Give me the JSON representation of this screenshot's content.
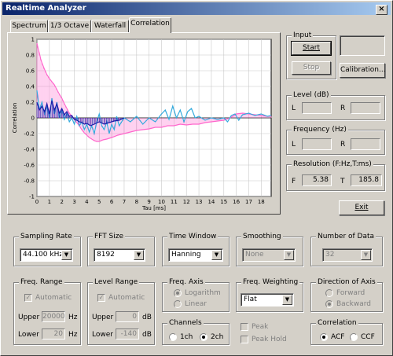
{
  "window": {
    "title": "Realtime Analyzer",
    "close_glyph": "×"
  },
  "tabs": [
    "Spectrum",
    "1/3 Octave",
    "Waterfall",
    "Correlation"
  ],
  "active_tab": 3,
  "chart_data": {
    "type": "line",
    "title": "",
    "xlabel": "Tau [ms]",
    "ylabel": "Correlation",
    "xlim": [
      0,
      18.8
    ],
    "ylim": [
      -1,
      1
    ],
    "xticks": [
      0,
      1,
      2,
      3,
      4,
      5,
      6,
      7,
      8,
      9,
      10,
      11,
      12,
      13,
      14,
      15,
      16,
      17,
      18
    ],
    "yticks": [
      "1",
      "0.8",
      "0.6",
      "0.4",
      "0.2",
      "0",
      "-0.2",
      "-0.4",
      "-0.6",
      "-0.8",
      "-1"
    ],
    "grid": true,
    "series": [
      {
        "color": "#ff66cc",
        "fill": true,
        "x": [
          0,
          0.1,
          0.2,
          0.3,
          0.4,
          0.6,
          0.8,
          1.0,
          1.2,
          1.4,
          1.6,
          1.8,
          2.0,
          2.2,
          2.4,
          2.6,
          2.8,
          3.0,
          3.2,
          3.4,
          3.6,
          3.8,
          4.0,
          4.2,
          4.4,
          4.6,
          4.8,
          5.0,
          5.3,
          5.6,
          6.0,
          6.5,
          7.0,
          7.5,
          8.0,
          8.5,
          9.0,
          9.5,
          10.0,
          10.5,
          11.0,
          11.5,
          12.0,
          12.5,
          13.0,
          13.5,
          14.0,
          14.5,
          15.0,
          15.5,
          16.0,
          16.5,
          17.0,
          17.5,
          18.0,
          18.5,
          18.8
        ],
        "y": [
          0.95,
          0.88,
          0.82,
          0.75,
          0.7,
          0.62,
          0.55,
          0.5,
          0.46,
          0.42,
          0.36,
          0.3,
          0.25,
          0.18,
          0.12,
          0.06,
          0.02,
          -0.02,
          -0.06,
          -0.1,
          -0.15,
          -0.19,
          -0.22,
          -0.25,
          -0.27,
          -0.29,
          -0.3,
          -0.3,
          -0.28,
          -0.27,
          -0.25,
          -0.22,
          -0.2,
          -0.18,
          -0.16,
          -0.15,
          -0.14,
          -0.12,
          -0.12,
          -0.1,
          -0.1,
          -0.08,
          -0.09,
          -0.08,
          -0.08,
          -0.06,
          -0.05,
          -0.04,
          -0.03,
          0.0,
          0.05,
          0.06,
          0.05,
          0.04,
          0.03,
          0.02,
          0.02
        ]
      },
      {
        "color": "#33aadd",
        "fill": false,
        "x": [
          0,
          0.2,
          0.4,
          0.6,
          0.8,
          1.0,
          1.2,
          1.4,
          1.6,
          1.8,
          2.0,
          2.2,
          2.4,
          2.6,
          2.8,
          3.0,
          3.2,
          3.4,
          3.6,
          3.8,
          4.0,
          4.2,
          4.4,
          4.6,
          4.8,
          5.0,
          5.2,
          5.4,
          5.6,
          5.8,
          6.0,
          6.2,
          6.4,
          6.6,
          6.8,
          7.0,
          7.5,
          8.0,
          8.5,
          9.0,
          9.5,
          10.0,
          10.3,
          10.6,
          10.9,
          11.2,
          11.5,
          11.8,
          12.1,
          12.4,
          12.7,
          13.0,
          13.5,
          14.0,
          14.5,
          15.0,
          15.3,
          15.6,
          15.9,
          16.2,
          16.5,
          17.0,
          17.5,
          18.0,
          18.5,
          18.8
        ],
        "y": [
          0.35,
          0.1,
          0.2,
          0.05,
          0.15,
          0.0,
          0.25,
          0.05,
          0.2,
          0.0,
          0.1,
          -0.02,
          0.05,
          -0.05,
          0.0,
          -0.08,
          0.02,
          -0.1,
          -0.05,
          -0.15,
          -0.08,
          -0.18,
          -0.1,
          -0.2,
          -0.05,
          0.05,
          -0.1,
          -0.15,
          -0.05,
          -0.2,
          -0.08,
          -0.15,
          0.02,
          -0.1,
          -0.05,
          0.0,
          -0.05,
          0.02,
          -0.08,
          0.0,
          -0.05,
          0.05,
          0.1,
          -0.02,
          0.15,
          0.0,
          0.1,
          -0.05,
          0.08,
          0.12,
          0.0,
          0.02,
          -0.03,
          0.0,
          -0.02,
          0.0,
          -0.05,
          0.03,
          0.05,
          -0.03,
          0.04,
          0.06,
          0.03,
          0.05,
          0.02,
          0.03
        ]
      },
      {
        "color": "#1a1aa8",
        "fill": true,
        "x": [
          0,
          0.2,
          0.4,
          0.6,
          0.8,
          1.0,
          1.2,
          1.4,
          1.6,
          1.8,
          2.0,
          2.2,
          2.4,
          2.6,
          2.8,
          3.0,
          3.2,
          3.4,
          3.6,
          3.8,
          4.0,
          4.3,
          4.6,
          5.0,
          5.4,
          5.8,
          6.2,
          6.6,
          7.0
        ],
        "y": [
          0.2,
          0.1,
          0.15,
          0.08,
          0.18,
          0.05,
          0.22,
          0.1,
          0.18,
          0.06,
          0.12,
          0.04,
          0.08,
          0.02,
          0.03,
          -0.02,
          -0.03,
          -0.05,
          -0.06,
          -0.08,
          -0.07,
          -0.1,
          -0.08,
          -0.05,
          -0.08,
          -0.06,
          -0.04,
          -0.03,
          0.0
        ]
      }
    ]
  },
  "input": {
    "title": "Input",
    "start": "Start",
    "stop": "Stop",
    "calibration": "Calibration..."
  },
  "level": {
    "title": "Level (dB)",
    "l": "L",
    "r": "R"
  },
  "frequency": {
    "title": "Frequency (Hz)",
    "l": "L",
    "r": "R"
  },
  "resolution": {
    "title": "Resolution (F:Hz,T:ms)",
    "f": "F",
    "t": "T",
    "f_value": "5.38",
    "t_value": "185.8"
  },
  "exit": "Exit",
  "sampling": {
    "title": "Sampling Rate",
    "value": "44.100 kHz"
  },
  "fft": {
    "title": "FFT Size",
    "value": "8192"
  },
  "window_fn": {
    "title": "Time Window",
    "value": "Hanning"
  },
  "smoothing": {
    "title": "Smoothing",
    "value": "None"
  },
  "ndata": {
    "title": "Number of Data",
    "value": "32"
  },
  "freq_range": {
    "title": "Freq. Range",
    "auto": "Automatic",
    "upper_label": "Upper",
    "upper": "20000",
    "upper_unit": "Hz",
    "lower_label": "Lower",
    "lower": "20",
    "lower_unit": "Hz"
  },
  "level_range": {
    "title": "Level Range",
    "auto": "Automatic",
    "upper_label": "Upper",
    "upper": "0",
    "upper_unit": "dB",
    "lower_label": "Lower",
    "lower": "-140",
    "lower_unit": "dB"
  },
  "freq_axis": {
    "title": "Freq. Axis",
    "log": "Logarithm",
    "lin": "Linear"
  },
  "channels": {
    "title": "Channels",
    "ch1": "1ch",
    "ch2": "2ch"
  },
  "weighting": {
    "title": "Freq. Weighting",
    "value": "Flat",
    "peak": "Peak",
    "peak_hold": "Peak Hold"
  },
  "direction": {
    "title": "Direction of Axis",
    "fwd": "Forward",
    "bwd": "Backward"
  },
  "correlation": {
    "title": "Correlation",
    "acf": "ACF",
    "ccf": "CCF"
  }
}
